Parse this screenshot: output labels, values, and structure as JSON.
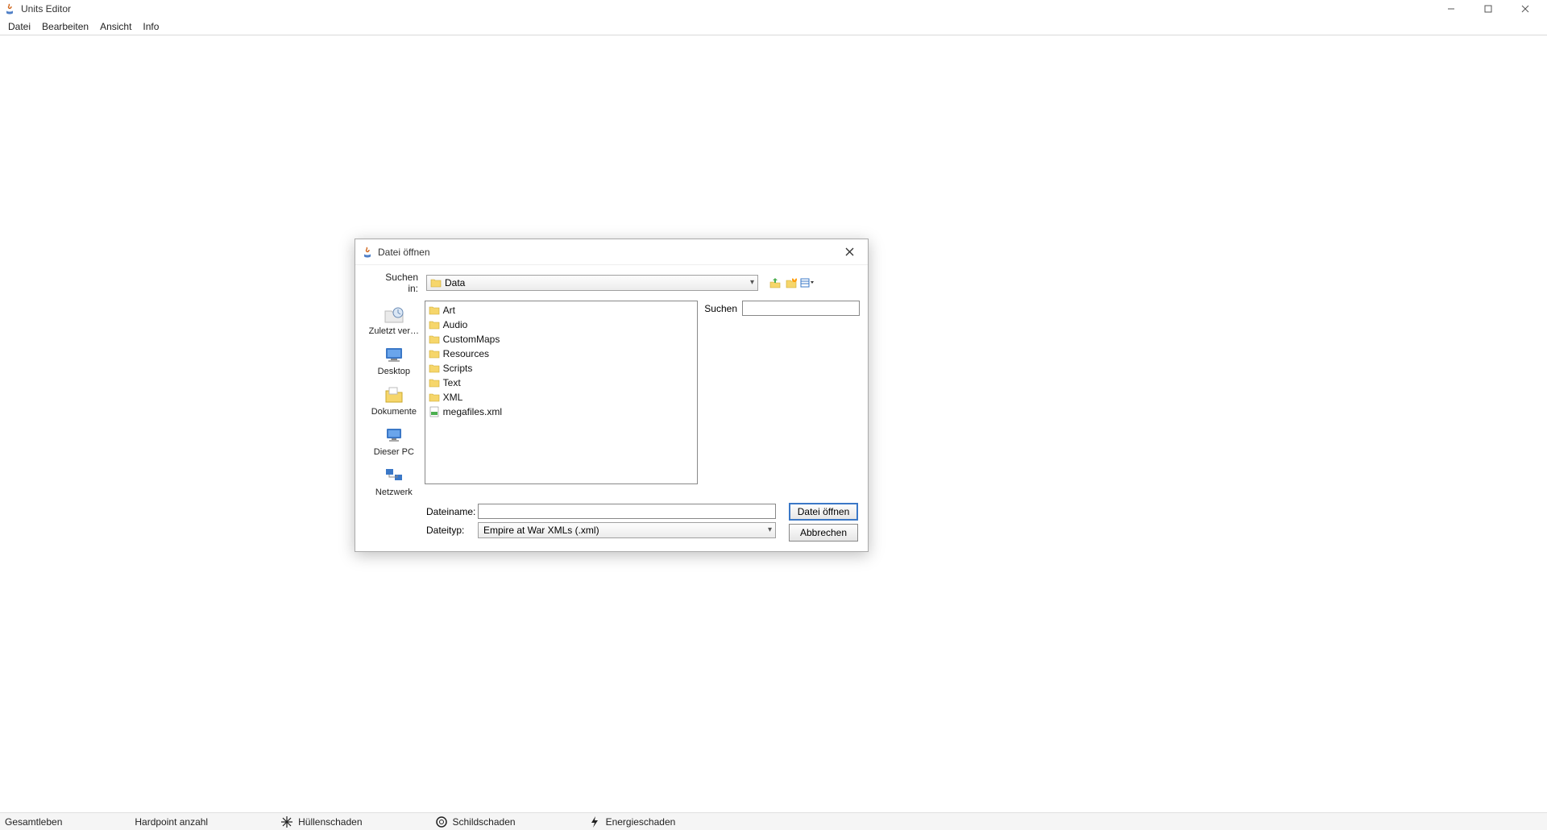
{
  "window": {
    "title": "Units Editor"
  },
  "menu": {
    "items": [
      "Datei",
      "Bearbeiten",
      "Ansicht",
      "Info"
    ]
  },
  "statusbar": {
    "items": [
      {
        "label": "Gesamtleben",
        "icon": "none"
      },
      {
        "label": "Hardpoint anzahl",
        "icon": "none"
      },
      {
        "label": "Hüllenschaden",
        "icon": "burst"
      },
      {
        "label": "Schildschaden",
        "icon": "ring"
      },
      {
        "label": "Energieschaden",
        "icon": "bolt"
      }
    ]
  },
  "dialog": {
    "title": "Datei öffnen",
    "lookin_label": "Suchen in:",
    "lookin_value": "Data",
    "places": [
      {
        "key": "recent",
        "label": "Zuletzt ver…",
        "icon": "recent"
      },
      {
        "key": "desktop",
        "label": "Desktop",
        "icon": "desktop"
      },
      {
        "key": "documents",
        "label": "Dokumente",
        "icon": "documents"
      },
      {
        "key": "thispc",
        "label": "Dieser PC",
        "icon": "pc"
      },
      {
        "key": "network",
        "label": "Netzwerk",
        "icon": "network"
      }
    ],
    "files": [
      {
        "name": "Art",
        "type": "folder"
      },
      {
        "name": "Audio",
        "type": "folder"
      },
      {
        "name": "CustomMaps",
        "type": "folder"
      },
      {
        "name": "Resources",
        "type": "folder"
      },
      {
        "name": "Scripts",
        "type": "folder"
      },
      {
        "name": "Text",
        "type": "folder"
      },
      {
        "name": "XML",
        "type": "folder"
      },
      {
        "name": "megafiles.xml",
        "type": "xml"
      }
    ],
    "search_label": "Suchen",
    "search_value": "",
    "filename_label": "Dateiname:",
    "filename_value": "",
    "filetype_label": "Dateityp:",
    "filetype_value": "Empire at War XMLs (.xml)",
    "open_button": "Datei öffnen",
    "cancel_button": "Abbrechen"
  }
}
